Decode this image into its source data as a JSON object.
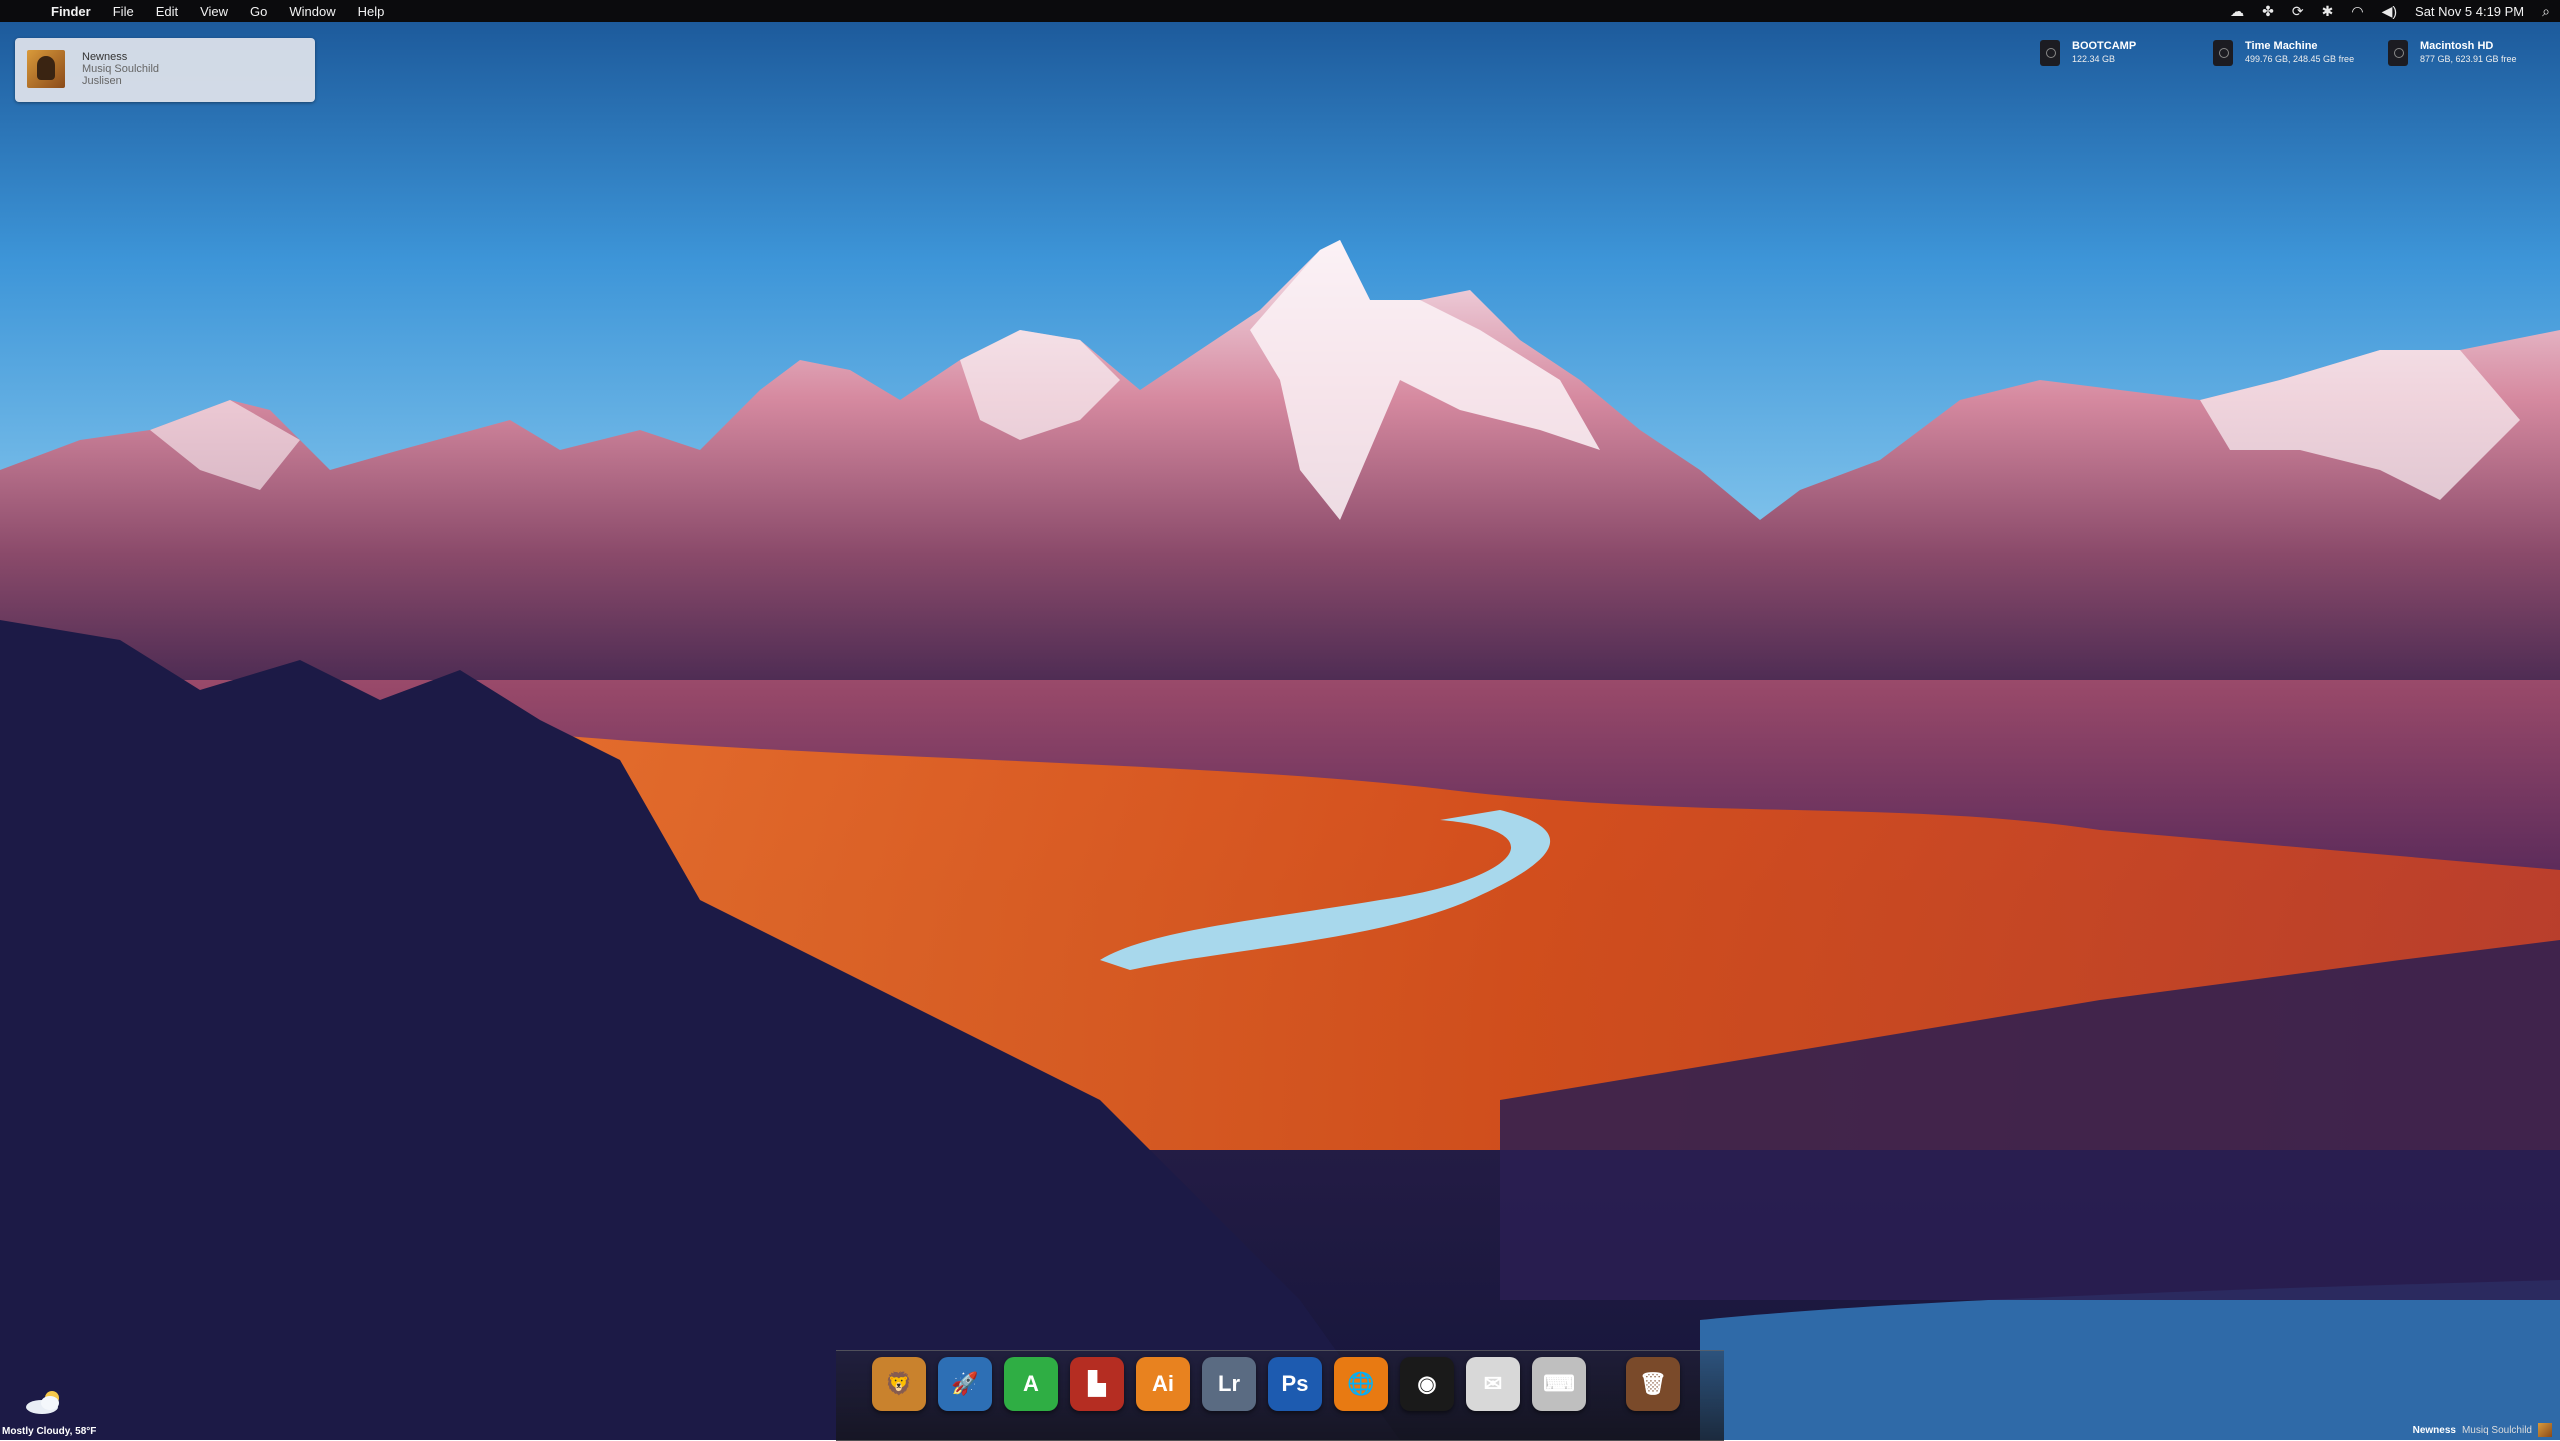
{
  "menubar": {
    "apple_icon": "apple-logo",
    "menus": [
      "Finder",
      "File",
      "Edit",
      "View",
      "Go",
      "Window",
      "Help"
    ],
    "status_icons": [
      "cloud-icon",
      "paw-icon",
      "sync-icon",
      "bluetooth-icon",
      "wifi-icon",
      "volume-icon"
    ],
    "clock": "Sat Nov 5  4:19 PM",
    "spotlight_icon": "search-icon"
  },
  "now_playing": {
    "title": "Newness",
    "artist": "Musiq Soulchild",
    "album": "Juslisen"
  },
  "drives": [
    {
      "name": "BOOTCAMP",
      "info": "122.34 GB"
    },
    {
      "name": "Time Machine",
      "info": "499.76 GB, 248.45 GB free"
    },
    {
      "name": "Macintosh HD",
      "info": "877 GB, 623.91 GB free"
    }
  ],
  "dock": {
    "apps": [
      {
        "name": "lion-icon",
        "glyph": "🦁",
        "color": "#c9822d"
      },
      {
        "name": "launchpad-icon",
        "glyph": "🚀",
        "color": "#2d6fb5"
      },
      {
        "name": "textmate-icon",
        "glyph": "A",
        "color": "#2fae44"
      },
      {
        "name": "building-icon",
        "glyph": "▙",
        "color": "#b52d22"
      },
      {
        "name": "illustrator-icon",
        "glyph": "Ai",
        "color": "#e8821f"
      },
      {
        "name": "lightroom-icon",
        "glyph": "Lr",
        "color": "#5a6b82"
      },
      {
        "name": "photoshop-icon",
        "glyph": "Ps",
        "color": "#1d5bb0"
      },
      {
        "name": "firefox-icon",
        "glyph": "🌐",
        "color": "#e87a12"
      },
      {
        "name": "speaker-icon",
        "glyph": "◉",
        "color": "#1a1a1a"
      },
      {
        "name": "mail-icon",
        "glyph": "✉",
        "color": "#d8d8d8"
      },
      {
        "name": "terminal-icon",
        "glyph": "⌨",
        "color": "#bfbfbf"
      },
      {
        "name": "trash-icon",
        "glyph": "🗑",
        "color": "#7a4a2a"
      }
    ]
  },
  "weather": {
    "icon": "cloud-sun-icon",
    "label": "Mostly Cloudy, 58°F"
  },
  "mini_player": {
    "title": "Newness",
    "artist": "Musiq Soulchild"
  }
}
